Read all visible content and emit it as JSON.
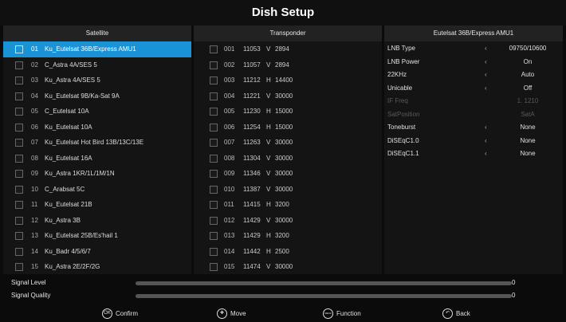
{
  "title": "Dish Setup",
  "satellite": {
    "header": "Satellite",
    "items": [
      {
        "num": "01",
        "name": "Ku_Eutelsat 36B/Express AMU1",
        "selected": true
      },
      {
        "num": "02",
        "name": "C_Astra 4A/SES 5"
      },
      {
        "num": "03",
        "name": "Ku_Astra 4A/SES 5"
      },
      {
        "num": "04",
        "name": "Ku_Eutelsat 9B/Ka-Sat 9A"
      },
      {
        "num": "05",
        "name": "C_Eutelsat 10A"
      },
      {
        "num": "06",
        "name": "Ku_Eutelsat 10A"
      },
      {
        "num": "07",
        "name": "Ku_Eutelsat Hot Bird 13B/13C/13E"
      },
      {
        "num": "08",
        "name": "Ku_Eutelsat 16A"
      },
      {
        "num": "09",
        "name": "Ku_Astra 1KR/1L/1M/1N"
      },
      {
        "num": "10",
        "name": "C_Arabsat 5C"
      },
      {
        "num": "11",
        "name": "Ku_Eutelsat 21B"
      },
      {
        "num": "12",
        "name": "Ku_Astra 3B"
      },
      {
        "num": "13",
        "name": "Ku_Eutelsat 25B/Es'hail 1"
      },
      {
        "num": "14",
        "name": "Ku_Badr 4/5/6/7"
      },
      {
        "num": "15",
        "name": "Ku_Astra 2E/2F/2G"
      }
    ]
  },
  "transponder": {
    "header": "Transponder",
    "items": [
      {
        "num": "001",
        "freq": "11053",
        "pol": "V",
        "sr": "2894"
      },
      {
        "num": "002",
        "freq": "11057",
        "pol": "V",
        "sr": "2894"
      },
      {
        "num": "003",
        "freq": "11212",
        "pol": "H",
        "sr": "14400"
      },
      {
        "num": "004",
        "freq": "11221",
        "pol": "V",
        "sr": "30000"
      },
      {
        "num": "005",
        "freq": "11230",
        "pol": "H",
        "sr": "15000"
      },
      {
        "num": "006",
        "freq": "11254",
        "pol": "H",
        "sr": "15000"
      },
      {
        "num": "007",
        "freq": "11263",
        "pol": "V",
        "sr": "30000"
      },
      {
        "num": "008",
        "freq": "11304",
        "pol": "V",
        "sr": "30000"
      },
      {
        "num": "009",
        "freq": "11346",
        "pol": "V",
        "sr": "30000"
      },
      {
        "num": "010",
        "freq": "11387",
        "pol": "V",
        "sr": "30000"
      },
      {
        "num": "011",
        "freq": "11415",
        "pol": "H",
        "sr": "3200"
      },
      {
        "num": "012",
        "freq": "11429",
        "pol": "V",
        "sr": "30000"
      },
      {
        "num": "013",
        "freq": "11429",
        "pol": "H",
        "sr": "3200"
      },
      {
        "num": "014",
        "freq": "11442",
        "pol": "H",
        "sr": "2500"
      },
      {
        "num": "015",
        "freq": "11474",
        "pol": "V",
        "sr": "30000"
      }
    ]
  },
  "settings": {
    "header": "Eutelsat 36B/Express AMU1",
    "items": [
      {
        "label": "LNB Type",
        "value": "09750/10600",
        "enabled": true
      },
      {
        "label": "LNB Power",
        "value": "On",
        "enabled": true
      },
      {
        "label": "22KHz",
        "value": "Auto",
        "enabled": true
      },
      {
        "label": "Unicable",
        "value": "Off",
        "enabled": true
      },
      {
        "label": "IF Freq",
        "value": "1. 1210",
        "enabled": false
      },
      {
        "label": "SatPosition",
        "value": "SatA",
        "enabled": false
      },
      {
        "label": "Toneburst",
        "value": "None",
        "enabled": true
      },
      {
        "label": "DiSEqC1.0",
        "value": "None",
        "enabled": true
      },
      {
        "label": "DiSEqC1.1",
        "value": "None",
        "enabled": true
      }
    ]
  },
  "signal": {
    "level_label": "Signal Level",
    "level_value": "0",
    "quality_label": "Signal Quality",
    "quality_value": "0"
  },
  "footer": {
    "confirm": "Confirm",
    "move": "Move",
    "function": "Function",
    "back": "Back",
    "confirm_icon_text": "OK",
    "function_icon_text": "MENU"
  }
}
